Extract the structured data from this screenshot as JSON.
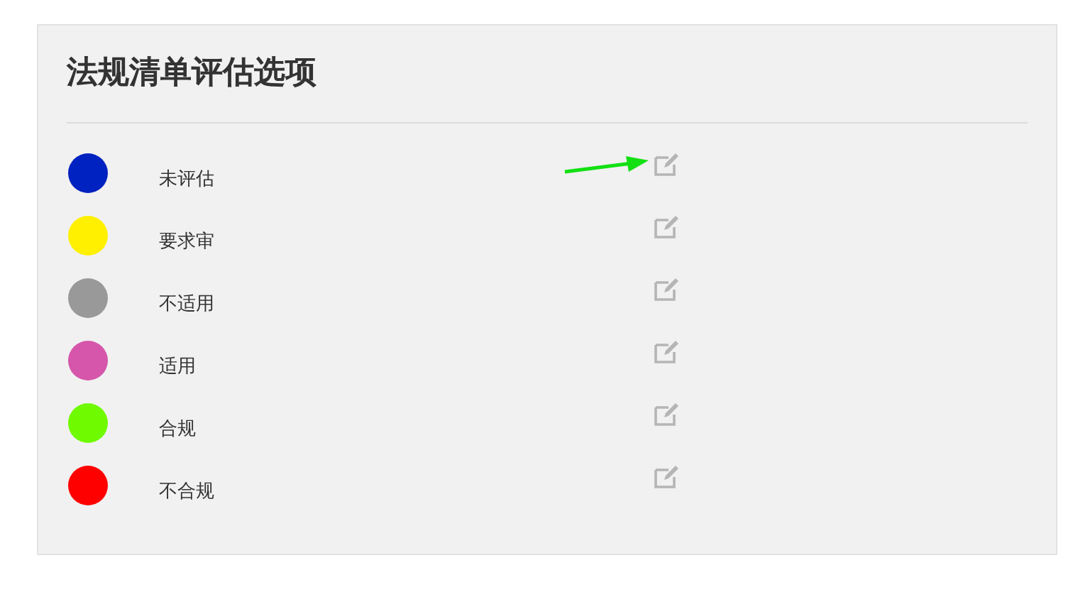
{
  "panel": {
    "title": "法规清单评估选项"
  },
  "options": [
    {
      "label": "未评估",
      "color": "#0022c0"
    },
    {
      "label": "要求审",
      "color": "#fff000"
    },
    {
      "label": "不适用",
      "color": "#999999"
    },
    {
      "label": "适用",
      "color": "#d556ab"
    },
    {
      "label": "合规",
      "color": "#70fa00"
    },
    {
      "label": "不合规",
      "color": "#ff0000"
    }
  ]
}
